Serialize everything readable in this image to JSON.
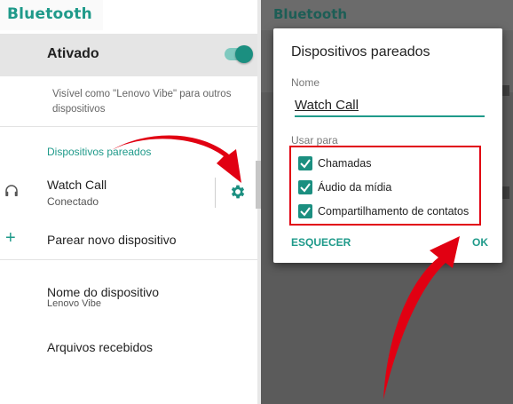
{
  "left_screen": {
    "app_title": "Bluetooth",
    "toggle": {
      "label": "Ativado",
      "on": true
    },
    "visibility_note": "Visível como \"Lenovo Vibe\" para outros dispositivos",
    "paired_section_label": "Dispositivos pareados",
    "paired_device": {
      "name": "Watch Call",
      "status": "Conectado",
      "icon": "headphones-icon",
      "settings_icon": "gear-icon"
    },
    "pair_new": {
      "icon": "plus-icon",
      "label": "Parear novo dispositivo"
    },
    "device_name": {
      "label": "Nome do dispositivo",
      "value": "Lenovo Vibe"
    },
    "received_files": {
      "label": "Arquivos recebidos"
    }
  },
  "right_screen": {
    "app_title": "Bluetooth",
    "dialog": {
      "title": "Dispositivos pareados",
      "name_label": "Nome",
      "name_value": "Watch Call",
      "use_for_label": "Usar para",
      "options": [
        {
          "label": "Chamadas",
          "checked": true
        },
        {
          "label": "Áudio da mídia",
          "checked": true
        },
        {
          "label": "Compartilhamento de contatos",
          "checked": true
        }
      ],
      "forget_button": "ESQUECER",
      "ok_button": "OK"
    }
  },
  "colors": {
    "accent": "#1f9a8a",
    "annotation": "#e10012"
  }
}
